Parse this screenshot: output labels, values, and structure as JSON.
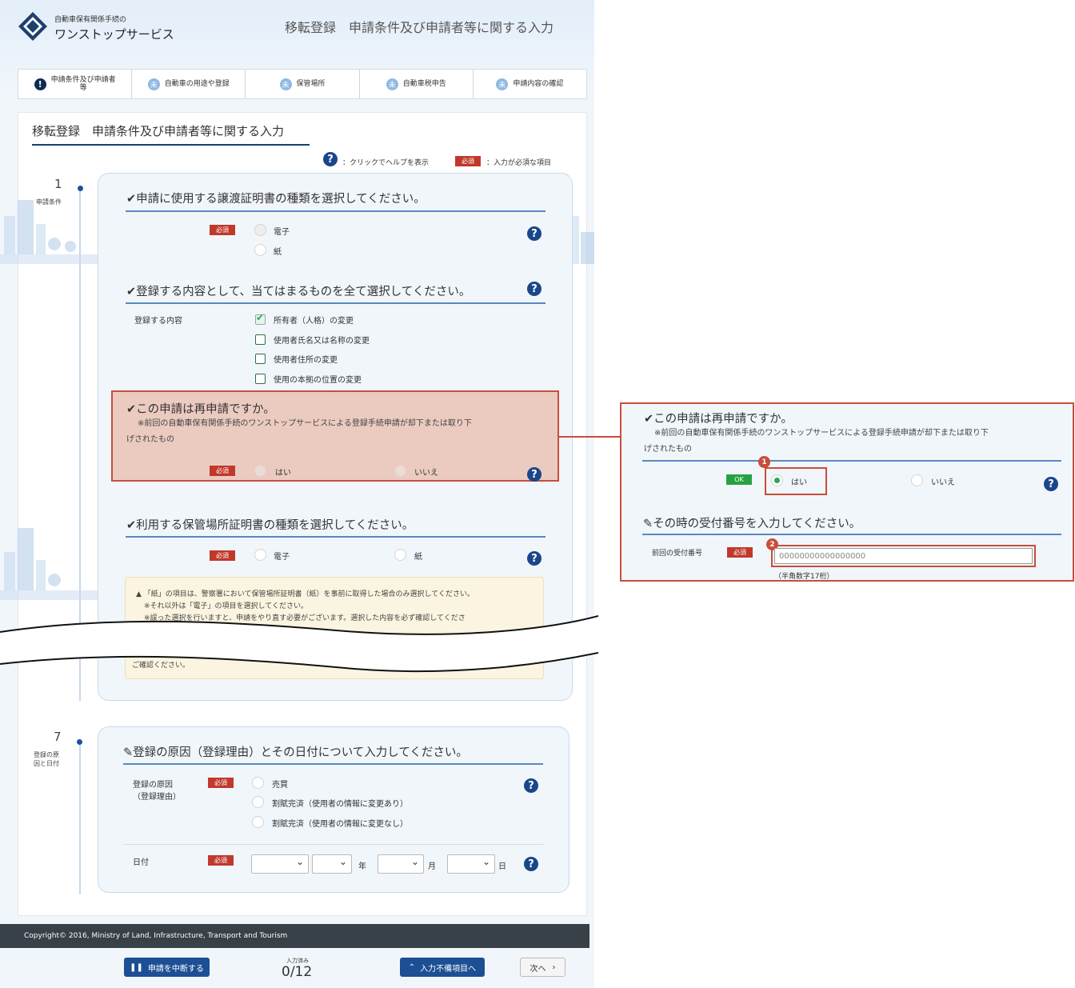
{
  "header": {
    "logo_line1": "自動車保有関係手続の",
    "logo_line2": "ワンストップサービス",
    "title": "移転登録　申請条件及び申請者等に関する入力"
  },
  "steps": [
    {
      "badge": "!",
      "label1": "申請条件及び申請者",
      "label2": "等"
    },
    {
      "badge": "未",
      "label1": "自動車の用途や登録",
      "label2": ""
    },
    {
      "badge": "未",
      "label1": "保管場所",
      "label2": ""
    },
    {
      "badge": "未",
      "label1": "自動車税申告",
      "label2": ""
    },
    {
      "badge": "未",
      "label1": "申請内容の確認",
      "label2": ""
    }
  ],
  "panel": {
    "title": "移転登録　申請条件及び申請者等に関する入力"
  },
  "legend": {
    "help_text": "：クリックでヘルプを表示",
    "required_badge": "必須",
    "required_text": "：入力が必須な項目"
  },
  "help_glyph": "?",
  "required_label": "必須",
  "section1": {
    "number": "1",
    "label": "申請条件"
  },
  "q1": {
    "title": "✔申請に使用する譲渡証明書の種類を選択してください。",
    "options": [
      "電子",
      "紙"
    ]
  },
  "q2": {
    "title": "✔登録する内容として、当てはまるものを全て選択してください。",
    "field_label": "登録する内容",
    "options": [
      "所有者（人格）の変更",
      "使用者氏名又は名称の変更",
      "使用者住所の変更",
      "使用の本拠の位置の変更"
    ]
  },
  "q3": {
    "title": "✔この申請は再申請ですか。",
    "note1": "※前回の自動車保有関係手続のワンストップサービスによる登録手続申請が却下または取り下",
    "note2": "げされたもの",
    "options": [
      "はい",
      "いいえ"
    ]
  },
  "q4": {
    "title": "✔利用する保管場所証明書の種類を選択してください。",
    "options": [
      "電子",
      "紙"
    ]
  },
  "warning": {
    "line1": "「紙」の項目は、警察署において保管場所証明書（紙）を事前に取得した場合のみ選択してください。",
    "line2": "※それ以外は「電子」の項目を選択してください。",
    "line3": "※誤った選択を行いますと、申請をやり直す必要がございます。選択した内容を必ず確認してくださ",
    "line4": "ご確認ください。"
  },
  "section7": {
    "number": "7",
    "label1": "登録の原",
    "label2": "因と日付"
  },
  "q7": {
    "title": "登録の原因（登録理由）とその日付について入力してください。",
    "cause_label1": "登録の原因",
    "cause_label2": "（登録理由）",
    "options": [
      "売買",
      "割賦完済（使用者の情報に変更あり）",
      "割賦完済（使用者の情報に変更なし）"
    ],
    "date_label": "日付",
    "year": "年",
    "month": "月",
    "day": "日"
  },
  "footer": {
    "copyright": "Copyright© 2016, Ministry of Land, Infrastructure, Transport and Tourism"
  },
  "bottom": {
    "suspend": "申請を中断する",
    "progress_label": "入力済み",
    "progress": "0/12",
    "missing": "入力不備項目へ",
    "next": "次へ"
  },
  "callout": {
    "title": "✔この申請は再申請ですか。",
    "note1": "※前回の自動車保有関係手続のワンストップサービスによる登録手続申請が却下または取り下",
    "note2": "げされたもの",
    "ok_badge": "OK",
    "yes": "はい",
    "no": "いいえ",
    "title2": "その時の受付番号を入力してください。",
    "field_label": "前回の受付番号",
    "input_value": "00000000000000000",
    "hint": "（半角数字17桁）",
    "marker1": "1",
    "marker2": "2"
  }
}
